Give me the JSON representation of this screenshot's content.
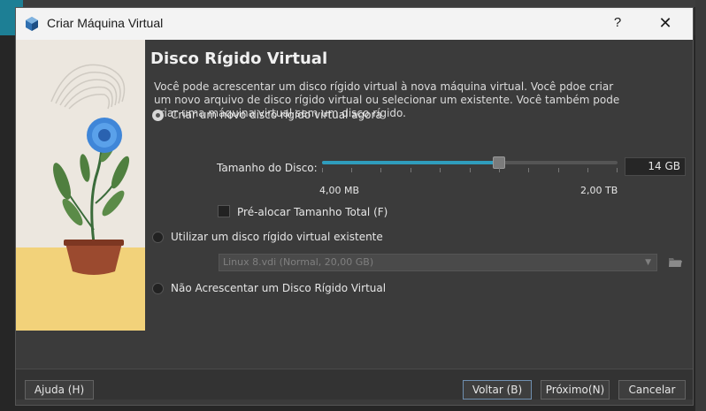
{
  "window": {
    "title": "Criar Máquina Virtual",
    "help_label": "?",
    "close_label": "✕"
  },
  "page": {
    "heading": "Disco Rígido Virtual",
    "description": "Você pode acrescentar um disco rígido virtual à nova máquina virtual. Você pdoe criar um novo arquivo de disco rígido virtual ou selecionar um existente. Você também pode criar uma máquina virtual sem um disco rígido."
  },
  "options": {
    "create_new": {
      "label": "Criar um novo disco rígido virtual agora",
      "selected": true
    },
    "use_existing": {
      "label": "Utilizar um disco rígido virtual existente",
      "selected": false
    },
    "no_disk": {
      "label": "Não Acrescentar um Disco Rígido Virtual",
      "selected": false
    }
  },
  "disk_size": {
    "label": "Tamanho do Disco:",
    "value": "14 GB",
    "min_label": "4,00 MB",
    "max_label": "2,00 TB",
    "fraction": 0.6
  },
  "preallocate": {
    "label": "Pré-alocar Tamanho Total (F)",
    "checked": false
  },
  "existing_disk": {
    "selected": "Linux 8.vdi (Normal, 20,00 GB)"
  },
  "buttons": {
    "help": "Ajuda (H)",
    "back": "Voltar (B)",
    "next": "Próximo(N)",
    "cancel": "Cancelar"
  },
  "colors": {
    "accent": "#2f9dbd",
    "dialog_bg": "#3b3b3b",
    "titlebar_bg": "#f3f3f3"
  }
}
